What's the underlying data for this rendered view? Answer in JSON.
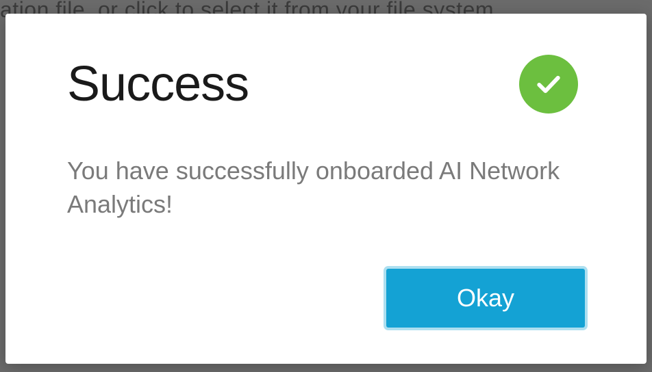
{
  "backdrop": {
    "text": "ation file, or click to select it from your file system."
  },
  "dialog": {
    "title": "Success",
    "message": "You have successfully onboarded AI Network Analytics!",
    "icon": "checkmark-circle",
    "actions": {
      "primary_label": "Okay"
    }
  },
  "colors": {
    "success": "#6cbf3f",
    "primary_button": "#14a2d4",
    "text_primary": "#1a1a1a",
    "text_secondary": "#7a7a7a"
  }
}
